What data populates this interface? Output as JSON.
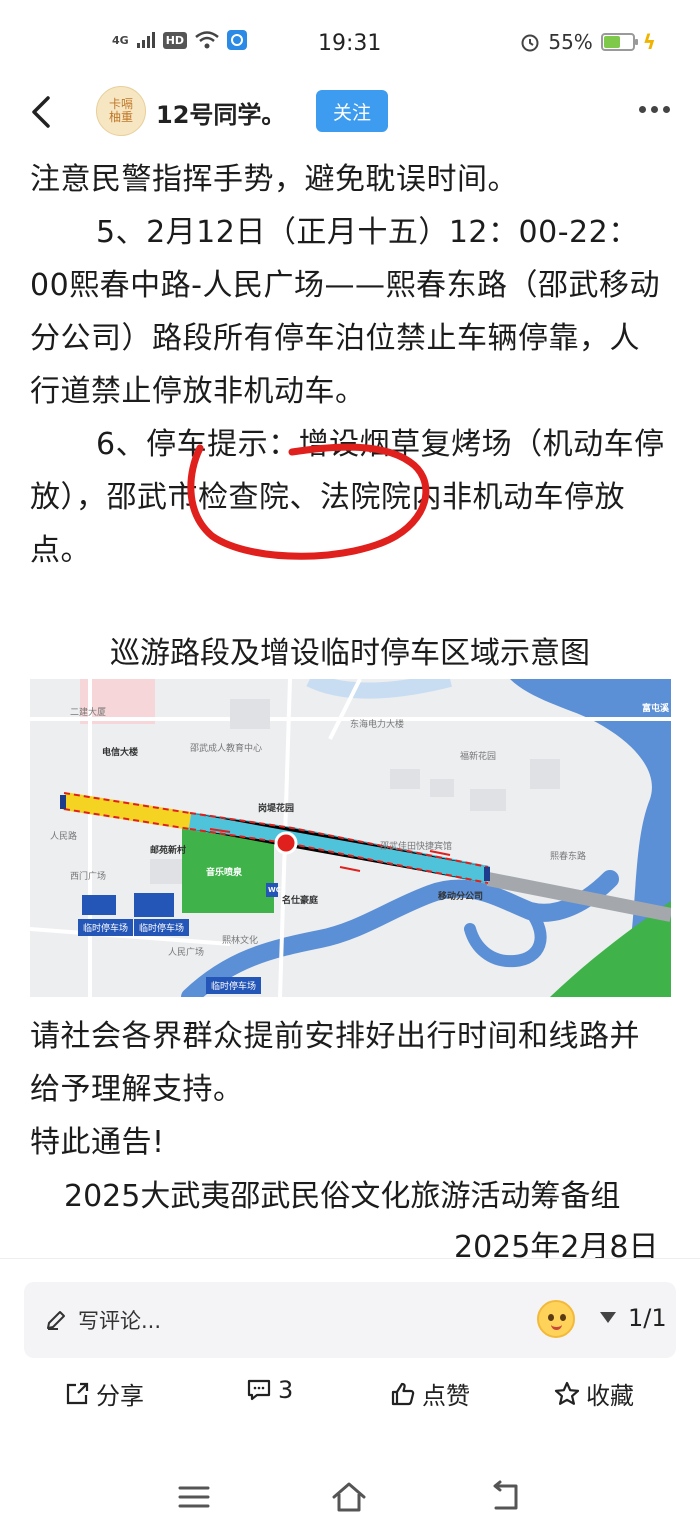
{
  "status_bar": {
    "time": "19:31",
    "signal": "4G",
    "hd_badge": "HD",
    "battery_percent": "55%",
    "battery_level": 0.55
  },
  "header": {
    "username": "12号同学。",
    "follow_label": "关注",
    "avatar_text": "卡嗝柚重"
  },
  "article": {
    "p1": "注意民警指挥手势，避免耽误时间。",
    "p2": "5、2月12日（正月十五）12：00-22：00熙春中路-人民广场——熙春东路（邵武移动分公司）路段所有停车泊位禁止车辆停靠，人行道禁止停放非机动车。",
    "p3": "6、停车提示：增设烟草复烤场（机动车停放），邵武市检查院、法院院内非机动车停放点。",
    "map_caption": "巡游路段及增设临时停车区域示意图",
    "p4": "请社会各界群众提前安排好出行时间和线路并给予理解支持。",
    "p5": "特此通告!",
    "signature": "2025大武夷邵武民俗文化旅游活动筹备组",
    "date": "2025年2月8日"
  },
  "map": {
    "labels": {
      "diancun": "电信大楼",
      "youyuan": "邮苑新村",
      "music": "音乐喷泉",
      "mingshi": "名仕豪庭",
      "mobile": "移动分公司",
      "park1": "临时停车场",
      "park2": "临时停车场",
      "park3": "临时停车场",
      "fuchun": "富屯溪",
      "wc": "WC",
      "gongtan": "岗堤花园",
      "minsheng": "邵武成人教育中心",
      "donghai": "东海电力大楼",
      "diantai": "熙春东路",
      "jiaoyu": "人民广场",
      "zhanbei": "邵武佳田快捷宾馆",
      "yuntai": "人民路",
      "wenhua": "熙林文化",
      "xiaoqu": "福新花园",
      "tiyu": "西门广场",
      "ershi": "二建大厦"
    }
  },
  "comment_bar": {
    "placeholder": "写评论...",
    "pager": "1/1"
  },
  "actions": {
    "share": "分享",
    "comments": "3",
    "like": "点赞",
    "favorite": "收藏"
  },
  "colors": {
    "follow_bg": "#3d9bf0",
    "annotation_red": "#e0201c",
    "route_cyan": "#4fc3d9",
    "route_yellow": "#f5d322",
    "park_green": "#3fb24a",
    "river_blue": "#5b8fd6"
  }
}
